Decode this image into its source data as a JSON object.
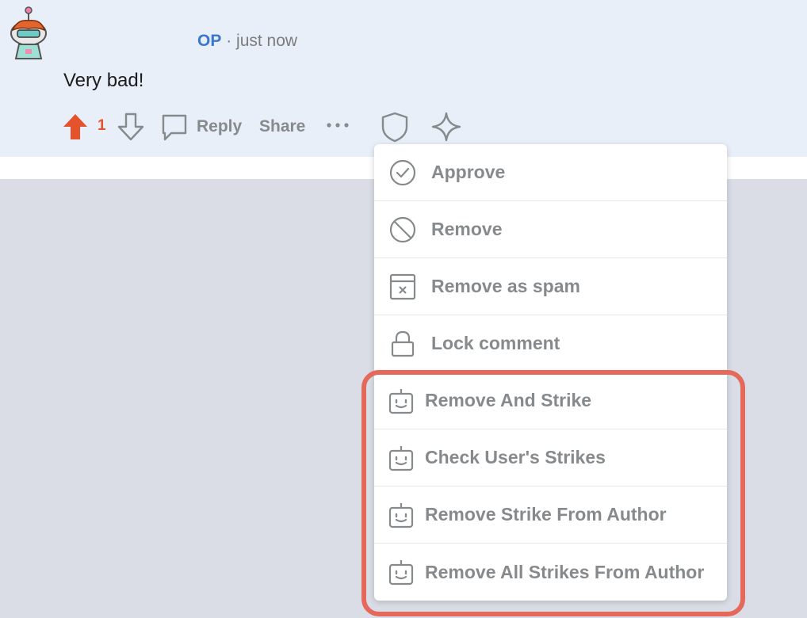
{
  "comment": {
    "author_badge": "OP",
    "separator": "·",
    "timestamp": "just now",
    "body": "Very bad!",
    "score": "1",
    "reply_label": "Reply",
    "share_label": "Share"
  },
  "mod_menu": {
    "items": [
      {
        "label": "Approve",
        "icon": "check-circle-icon"
      },
      {
        "label": "Remove",
        "icon": "prohibited-icon"
      },
      {
        "label": "Remove as spam",
        "icon": "spam-box-icon"
      },
      {
        "label": "Lock comment",
        "icon": "lock-icon"
      },
      {
        "label": "Remove And Strike",
        "icon": "bot-icon"
      },
      {
        "label": "Check User's Strikes",
        "icon": "bot-icon"
      },
      {
        "label": "Remove Strike From Author",
        "icon": "bot-icon"
      },
      {
        "label": "Remove All Strikes From Author",
        "icon": "bot-icon"
      }
    ]
  },
  "colors": {
    "upvote_active": "#e4532c",
    "op_blue": "#3a77d1",
    "highlight_border": "#e5695b",
    "comment_bg": "#e9eff9"
  }
}
